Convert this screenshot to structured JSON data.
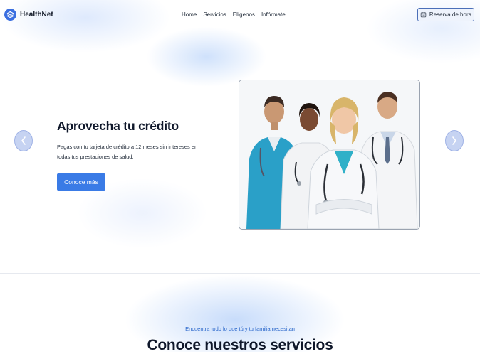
{
  "header": {
    "brand": "HealthNet",
    "nav": [
      "Home",
      "Servicios",
      "Elígenos",
      "Infórmate"
    ],
    "reserve_label": "Reserva de hora"
  },
  "hero": {
    "title": "Aprovecha tu crédito",
    "text": "Pagas con tu tarjeta de crédito a 12 meses sin intereses en todas tus prestaciones de salud.",
    "cta_label": "Conoce más"
  },
  "services": {
    "kicker": "Encuentra todo lo que tú y tu familia necesitan",
    "title": "Conoce nuestros servicios"
  },
  "colors": {
    "accent": "#3a7be6",
    "brand": "#3b6fe0",
    "kicker": "#2563c9"
  },
  "icons": {
    "brand": "layers-icon",
    "reserve": "calendar-icon",
    "prev": "chevron-left-icon",
    "next": "chevron-right-icon"
  }
}
